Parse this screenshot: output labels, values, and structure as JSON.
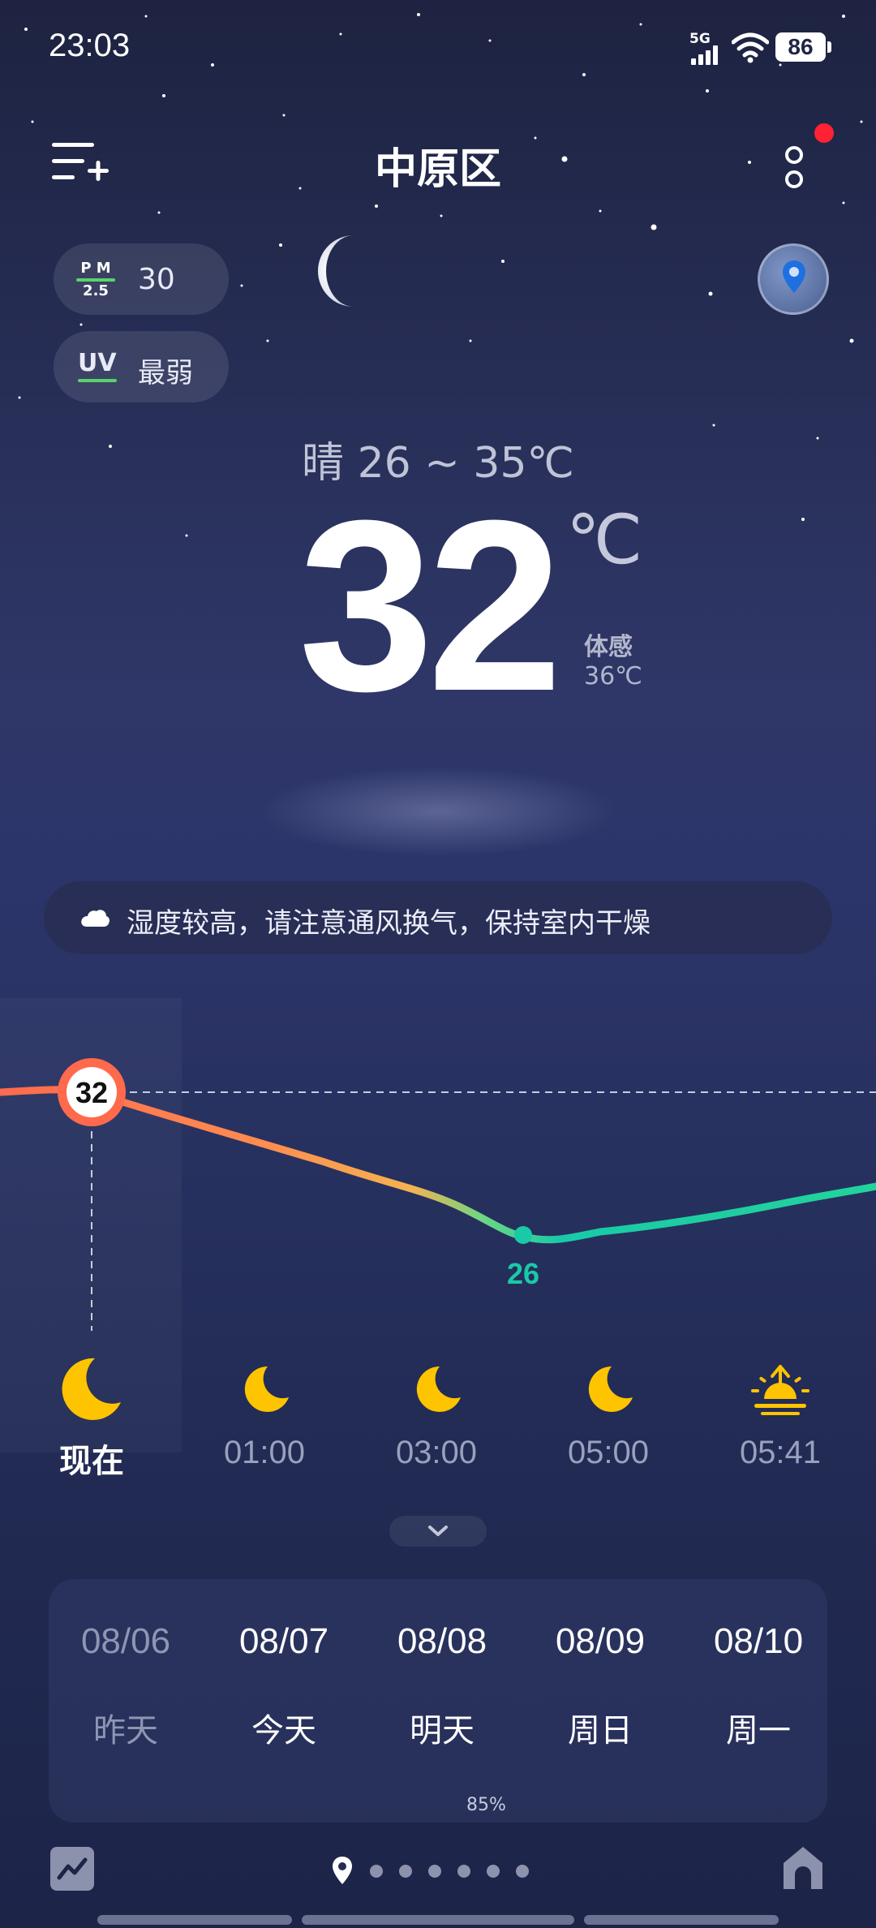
{
  "status_bar": {
    "time": "23:03",
    "network": "5G",
    "battery": "86"
  },
  "header": {
    "city": "中原区"
  },
  "chips": {
    "pm_top": "P M",
    "pm_bottom": "2.5",
    "pm_value": "30",
    "uv_label": "UV",
    "uv_value": "最弱"
  },
  "current": {
    "condition": "晴  26 ~ 35℃",
    "temperature": "32",
    "unit": "℃",
    "feels_label": "体感",
    "feels_value": "36℃"
  },
  "tip": {
    "text": "湿度较高，请注意通风换气，保持室内干燥"
  },
  "hourly": {
    "current_temp": "32",
    "min_temp": "26",
    "items": [
      {
        "label": "现在",
        "icon": "moon-icon"
      },
      {
        "label": "01:00",
        "icon": "moon-icon"
      },
      {
        "label": "03:00",
        "icon": "moon-icon"
      },
      {
        "label": "05:00",
        "icon": "moon-icon"
      },
      {
        "label": "05:41",
        "icon": "sunrise-icon"
      }
    ]
  },
  "daily": {
    "items": [
      {
        "date": "08/06",
        "name": "昨天"
      },
      {
        "date": "08/07",
        "name": "今天"
      },
      {
        "date": "08/08",
        "name": "明天"
      },
      {
        "date": "08/09",
        "name": "周日"
      },
      {
        "date": "08/10",
        "name": "周一"
      }
    ],
    "precip_label": "85%"
  },
  "colors": {
    "accent_warm": "#ff6a4d",
    "accent_cool": "#19c9a8",
    "notification": "#ff2233",
    "moon": "#ffc400"
  }
}
